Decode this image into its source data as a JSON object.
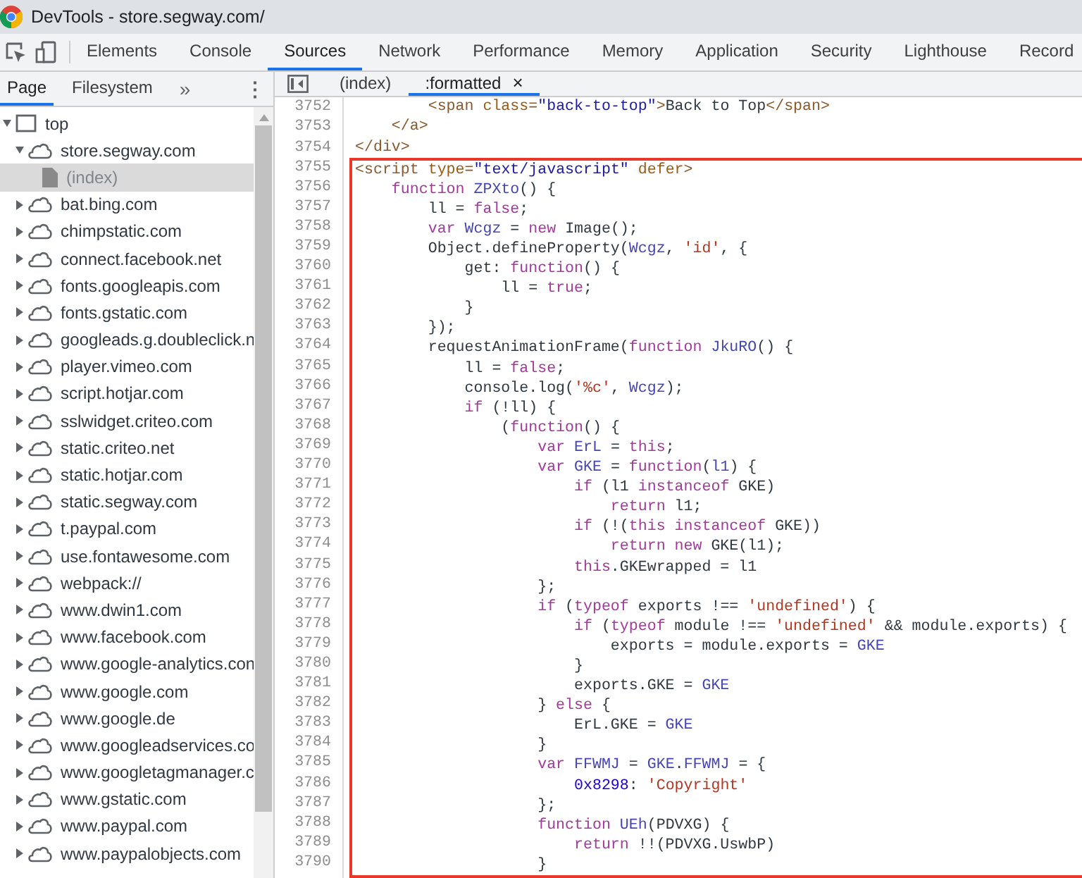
{
  "window": {
    "title": "DevTools - store.segway.com/"
  },
  "toolbar_tabs": [
    {
      "label": "Elements",
      "selected": false
    },
    {
      "label": "Console",
      "selected": false
    },
    {
      "label": "Sources",
      "selected": true
    },
    {
      "label": "Network",
      "selected": false
    },
    {
      "label": "Performance",
      "selected": false
    },
    {
      "label": "Memory",
      "selected": false
    },
    {
      "label": "Application",
      "selected": false
    },
    {
      "label": "Security",
      "selected": false
    },
    {
      "label": "Lighthouse",
      "selected": false
    },
    {
      "label": "Record",
      "selected": false
    }
  ],
  "navigator": {
    "tabs": [
      {
        "label": "Page",
        "selected": true
      },
      {
        "label": "Filesystem",
        "selected": false
      }
    ],
    "more": "»",
    "menu": "⋮",
    "tree": [
      {
        "label": "top",
        "kind": "frame",
        "expanded": true,
        "selected": false,
        "children": [
          {
            "label": "store.segway.com",
            "kind": "domain",
            "expanded": true,
            "selected": false,
            "children": [
              {
                "label": "(index)",
                "kind": "file",
                "selected": true
              }
            ]
          },
          {
            "label": "bat.bing.com",
            "kind": "domain",
            "expanded": false,
            "selected": false
          },
          {
            "label": "chimpstatic.com",
            "kind": "domain",
            "expanded": false,
            "selected": false
          },
          {
            "label": "connect.facebook.net",
            "kind": "domain",
            "expanded": false,
            "selected": false
          },
          {
            "label": "fonts.googleapis.com",
            "kind": "domain",
            "expanded": false,
            "selected": false
          },
          {
            "label": "fonts.gstatic.com",
            "kind": "domain",
            "expanded": false,
            "selected": false
          },
          {
            "label": "googleads.g.doubleclick.n",
            "kind": "domain",
            "expanded": false,
            "selected": false
          },
          {
            "label": "player.vimeo.com",
            "kind": "domain",
            "expanded": false,
            "selected": false
          },
          {
            "label": "script.hotjar.com",
            "kind": "domain",
            "expanded": false,
            "selected": false
          },
          {
            "label": "sslwidget.criteo.com",
            "kind": "domain",
            "expanded": false,
            "selected": false
          },
          {
            "label": "static.criteo.net",
            "kind": "domain",
            "expanded": false,
            "selected": false
          },
          {
            "label": "static.hotjar.com",
            "kind": "domain",
            "expanded": false,
            "selected": false
          },
          {
            "label": "static.segway.com",
            "kind": "domain",
            "expanded": false,
            "selected": false
          },
          {
            "label": "t.paypal.com",
            "kind": "domain",
            "expanded": false,
            "selected": false
          },
          {
            "label": "use.fontawesome.com",
            "kind": "domain",
            "expanded": false,
            "selected": false
          },
          {
            "label": "webpack://",
            "kind": "domain",
            "expanded": false,
            "selected": false
          },
          {
            "label": "www.dwin1.com",
            "kind": "domain",
            "expanded": false,
            "selected": false
          },
          {
            "label": "www.facebook.com",
            "kind": "domain",
            "expanded": false,
            "selected": false
          },
          {
            "label": "www.google-analytics.con",
            "kind": "domain",
            "expanded": false,
            "selected": false
          },
          {
            "label": "www.google.com",
            "kind": "domain",
            "expanded": false,
            "selected": false
          },
          {
            "label": "www.google.de",
            "kind": "domain",
            "expanded": false,
            "selected": false
          },
          {
            "label": "www.googleadservices.co",
            "kind": "domain",
            "expanded": false,
            "selected": false
          },
          {
            "label": "www.googletagmanager.c",
            "kind": "domain",
            "expanded": false,
            "selected": false
          },
          {
            "label": "www.gstatic.com",
            "kind": "domain",
            "expanded": false,
            "selected": false
          },
          {
            "label": "www.paypal.com",
            "kind": "domain",
            "expanded": false,
            "selected": false
          },
          {
            "label": "www.paypalobjects.com",
            "kind": "domain",
            "expanded": false,
            "selected": false
          }
        ]
      }
    ]
  },
  "editor": {
    "tabs": [
      {
        "label": "(index)",
        "selected": false
      },
      {
        "label": ":formatted",
        "selected": true,
        "close": "×"
      }
    ],
    "lines": [
      {
        "number": "3752",
        "boxed": false,
        "segs": [
          {
            "kind": "tag",
            "text": "        <span "
          },
          {
            "kind": "attr",
            "text": "class"
          },
          {
            "kind": "tag",
            "text": "="
          },
          {
            "kind": "val",
            "text": "\"back-to-top\""
          },
          {
            "kind": "tag",
            "text": ">"
          },
          {
            "kind": "plain",
            "text": "Back to Top"
          },
          {
            "kind": "tag",
            "text": "</span>"
          }
        ]
      },
      {
        "number": "3753",
        "boxed": false,
        "segs": [
          {
            "kind": "tag",
            "text": "    </a>"
          }
        ]
      },
      {
        "number": "3754",
        "boxed": false,
        "segs": [
          {
            "kind": "tag",
            "text": "</div>"
          }
        ]
      },
      {
        "number": "3755",
        "boxed": true,
        "segs": [
          {
            "kind": "tag",
            "text": "<script "
          },
          {
            "kind": "attr",
            "text": "type"
          },
          {
            "kind": "tag",
            "text": "="
          },
          {
            "kind": "val",
            "text": "\"text/javascript\""
          },
          {
            "kind": "attr",
            "text": " defer"
          },
          {
            "kind": "tag",
            "text": ">"
          }
        ]
      },
      {
        "number": "3756",
        "boxed": true,
        "segs": [
          {
            "kind": "kw",
            "text": "    function "
          },
          {
            "kind": "var",
            "text": "ZPXto"
          },
          {
            "kind": "plain",
            "text": "() {"
          }
        ]
      },
      {
        "number": "3757",
        "boxed": true,
        "segs": [
          {
            "kind": "plain",
            "text": "        ll = "
          },
          {
            "kind": "kw",
            "text": "false"
          },
          {
            "kind": "plain",
            "text": ";"
          }
        ]
      },
      {
        "number": "3758",
        "boxed": true,
        "segs": [
          {
            "kind": "kw",
            "text": "        var "
          },
          {
            "kind": "var",
            "text": "Wcgz"
          },
          {
            "kind": "plain",
            "text": " = "
          },
          {
            "kind": "kw",
            "text": "new "
          },
          {
            "kind": "plain",
            "text": "Image();"
          }
        ]
      },
      {
        "number": "3759",
        "boxed": true,
        "segs": [
          {
            "kind": "plain",
            "text": "        Object.defineProperty("
          },
          {
            "kind": "var",
            "text": "Wcgz"
          },
          {
            "kind": "plain",
            "text": ", "
          },
          {
            "kind": "str",
            "text": "'id'"
          },
          {
            "kind": "plain",
            "text": ", {"
          }
        ]
      },
      {
        "number": "3760",
        "boxed": true,
        "segs": [
          {
            "kind": "plain",
            "text": "            get: "
          },
          {
            "kind": "kw",
            "text": "function"
          },
          {
            "kind": "plain",
            "text": "() {"
          }
        ]
      },
      {
        "number": "3761",
        "boxed": true,
        "segs": [
          {
            "kind": "plain",
            "text": "                ll = "
          },
          {
            "kind": "kw",
            "text": "true"
          },
          {
            "kind": "plain",
            "text": ";"
          }
        ]
      },
      {
        "number": "3762",
        "boxed": true,
        "segs": [
          {
            "kind": "plain",
            "text": "            }"
          }
        ]
      },
      {
        "number": "3763",
        "boxed": true,
        "segs": [
          {
            "kind": "plain",
            "text": "        });"
          }
        ]
      },
      {
        "number": "3764",
        "boxed": true,
        "segs": [
          {
            "kind": "plain",
            "text": "        requestAnimationFrame("
          },
          {
            "kind": "kw",
            "text": "function "
          },
          {
            "kind": "var",
            "text": "JkuRO"
          },
          {
            "kind": "plain",
            "text": "() {"
          }
        ]
      },
      {
        "number": "3765",
        "boxed": true,
        "segs": [
          {
            "kind": "plain",
            "text": "            ll = "
          },
          {
            "kind": "kw",
            "text": "false"
          },
          {
            "kind": "plain",
            "text": ";"
          }
        ]
      },
      {
        "number": "3766",
        "boxed": true,
        "segs": [
          {
            "kind": "plain",
            "text": "            console.log("
          },
          {
            "kind": "str",
            "text": "'%c'"
          },
          {
            "kind": "plain",
            "text": ", "
          },
          {
            "kind": "var",
            "text": "Wcgz"
          },
          {
            "kind": "plain",
            "text": ");"
          }
        ]
      },
      {
        "number": "3767",
        "boxed": true,
        "segs": [
          {
            "kind": "kw",
            "text": "            if "
          },
          {
            "kind": "plain",
            "text": "(!ll) {"
          }
        ]
      },
      {
        "number": "3768",
        "boxed": true,
        "segs": [
          {
            "kind": "plain",
            "text": "                ("
          },
          {
            "kind": "kw",
            "text": "function"
          },
          {
            "kind": "plain",
            "text": "() {"
          }
        ]
      },
      {
        "number": "3769",
        "boxed": true,
        "segs": [
          {
            "kind": "kw",
            "text": "                    var "
          },
          {
            "kind": "var",
            "text": "ErL"
          },
          {
            "kind": "plain",
            "text": " = "
          },
          {
            "kind": "kw",
            "text": "this"
          },
          {
            "kind": "plain",
            "text": ";"
          }
        ]
      },
      {
        "number": "3770",
        "boxed": true,
        "segs": [
          {
            "kind": "kw",
            "text": "                    var "
          },
          {
            "kind": "var",
            "text": "GKE"
          },
          {
            "kind": "plain",
            "text": " = "
          },
          {
            "kind": "kw",
            "text": "function"
          },
          {
            "kind": "plain",
            "text": "("
          },
          {
            "kind": "var",
            "text": "l1"
          },
          {
            "kind": "plain",
            "text": ") {"
          }
        ]
      },
      {
        "number": "3771",
        "boxed": true,
        "segs": [
          {
            "kind": "kw",
            "text": "                        if "
          },
          {
            "kind": "plain",
            "text": "(l1 "
          },
          {
            "kind": "kw",
            "text": "instanceof "
          },
          {
            "kind": "plain",
            "text": "GKE)"
          }
        ]
      },
      {
        "number": "3772",
        "boxed": true,
        "segs": [
          {
            "kind": "kw",
            "text": "                            return "
          },
          {
            "kind": "plain",
            "text": "l1;"
          }
        ]
      },
      {
        "number": "3773",
        "boxed": true,
        "segs": [
          {
            "kind": "kw",
            "text": "                        if "
          },
          {
            "kind": "plain",
            "text": "(!("
          },
          {
            "kind": "kw",
            "text": "this instanceof "
          },
          {
            "kind": "plain",
            "text": "GKE))"
          }
        ]
      },
      {
        "number": "3774",
        "boxed": true,
        "segs": [
          {
            "kind": "kw",
            "text": "                            return new "
          },
          {
            "kind": "plain",
            "text": "GKE(l1);"
          }
        ]
      },
      {
        "number": "3775",
        "boxed": true,
        "segs": [
          {
            "kind": "kw",
            "text": "                        this"
          },
          {
            "kind": "plain",
            "text": ".GKEwrapped = l1"
          }
        ]
      },
      {
        "number": "3776",
        "boxed": true,
        "segs": [
          {
            "kind": "plain",
            "text": "                    };"
          }
        ]
      },
      {
        "number": "3777",
        "boxed": true,
        "segs": [
          {
            "kind": "kw",
            "text": "                    if "
          },
          {
            "kind": "plain",
            "text": "("
          },
          {
            "kind": "kw",
            "text": "typeof "
          },
          {
            "kind": "plain",
            "text": "exports !== "
          },
          {
            "kind": "str",
            "text": "'undefined'"
          },
          {
            "kind": "plain",
            "text": ") {"
          }
        ]
      },
      {
        "number": "3778",
        "boxed": true,
        "segs": [
          {
            "kind": "kw",
            "text": "                        if "
          },
          {
            "kind": "plain",
            "text": "("
          },
          {
            "kind": "kw",
            "text": "typeof "
          },
          {
            "kind": "plain",
            "text": "module !== "
          },
          {
            "kind": "str",
            "text": "'undefined'"
          },
          {
            "kind": "plain",
            "text": " && module.exports) {"
          }
        ]
      },
      {
        "number": "3779",
        "boxed": true,
        "segs": [
          {
            "kind": "plain",
            "text": "                            exports = module.exports = "
          },
          {
            "kind": "var",
            "text": "GKE"
          }
        ]
      },
      {
        "number": "3780",
        "boxed": true,
        "segs": [
          {
            "kind": "plain",
            "text": "                        }"
          }
        ]
      },
      {
        "number": "3781",
        "boxed": true,
        "segs": [
          {
            "kind": "plain",
            "text": "                        exports.GKE = "
          },
          {
            "kind": "var",
            "text": "GKE"
          }
        ]
      },
      {
        "number": "3782",
        "boxed": true,
        "segs": [
          {
            "kind": "plain",
            "text": "                    } "
          },
          {
            "kind": "kw",
            "text": "else "
          },
          {
            "kind": "plain",
            "text": "{"
          }
        ]
      },
      {
        "number": "3783",
        "boxed": true,
        "segs": [
          {
            "kind": "plain",
            "text": "                        ErL.GKE = "
          },
          {
            "kind": "var",
            "text": "GKE"
          }
        ]
      },
      {
        "number": "3784",
        "boxed": true,
        "segs": [
          {
            "kind": "plain",
            "text": "                    }"
          }
        ]
      },
      {
        "number": "3785",
        "boxed": true,
        "segs": [
          {
            "kind": "kw",
            "text": "                    var "
          },
          {
            "kind": "var",
            "text": "FFWMJ"
          },
          {
            "kind": "plain",
            "text": " = "
          },
          {
            "kind": "var",
            "text": "GKE"
          },
          {
            "kind": "plain",
            "text": "."
          },
          {
            "kind": "var",
            "text": "FFWMJ"
          },
          {
            "kind": "plain",
            "text": " = {"
          }
        ]
      },
      {
        "number": "3786",
        "boxed": true,
        "segs": [
          {
            "kind": "num",
            "text": "                        0x8298"
          },
          {
            "kind": "plain",
            "text": ": "
          },
          {
            "kind": "str",
            "text": "'Copyright'"
          }
        ]
      },
      {
        "number": "3787",
        "boxed": true,
        "segs": [
          {
            "kind": "plain",
            "text": "                    };"
          }
        ]
      },
      {
        "number": "3788",
        "boxed": true,
        "segs": [
          {
            "kind": "kw",
            "text": "                    function "
          },
          {
            "kind": "var",
            "text": "UEh"
          },
          {
            "kind": "plain",
            "text": "(PDVXG) {"
          }
        ]
      },
      {
        "number": "3789",
        "boxed": true,
        "segs": [
          {
            "kind": "kw",
            "text": "                        return "
          },
          {
            "kind": "plain",
            "text": "!!(PDVXG.UswbP)"
          }
        ]
      },
      {
        "number": "3790",
        "boxed": true,
        "segs": [
          {
            "kind": "plain",
            "text": "                    }"
          }
        ]
      }
    ]
  }
}
